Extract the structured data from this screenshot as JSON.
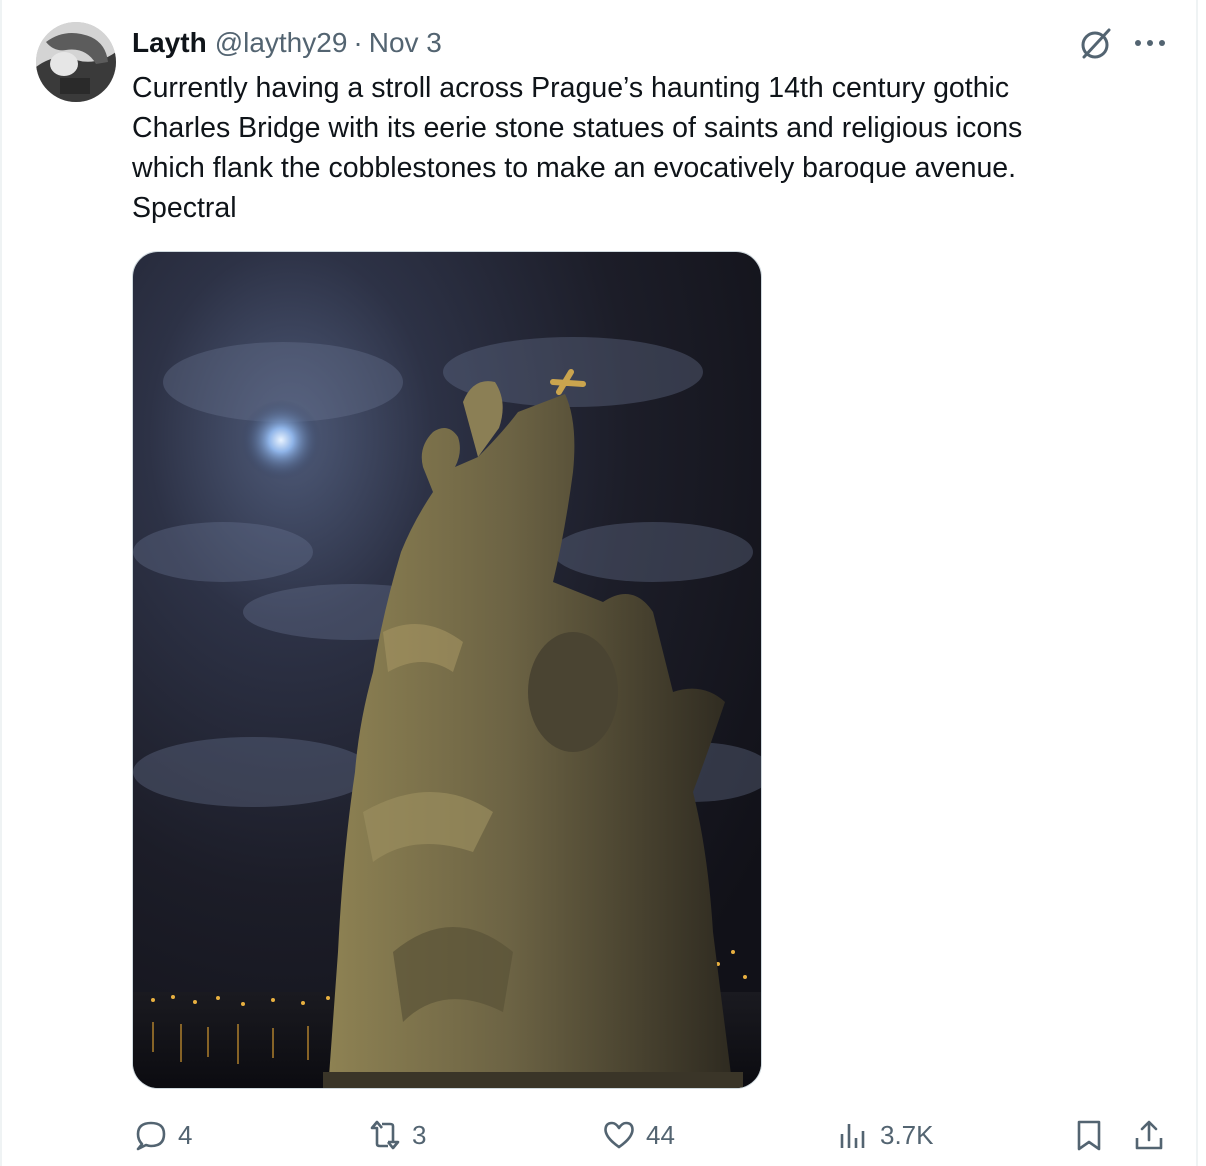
{
  "tweet": {
    "author_name": "Layth",
    "author_handle": "@laythy29",
    "separator": "·",
    "date": "Nov 3",
    "text_lines": [
      "Currently having a stroll across Prague’s haunting 14th century gothic",
      "Charles Bridge with its eerie stone statues of saints and religious icons",
      "which flank the cobblestones to make an evocatively baroque avenue.",
      "Spectral"
    ]
  },
  "actions": {
    "replies": "4",
    "reposts": "3",
    "likes": "44",
    "views": "3.7K"
  },
  "icons": {
    "header": [
      "grok-icon",
      "more-icon"
    ],
    "actions": [
      "reply-icon",
      "repost-icon",
      "like-icon",
      "views-icon",
      "bookmark-icon",
      "share-icon"
    ]
  },
  "colors": {
    "text": "#0f1419",
    "secondary": "#536471",
    "border": "#cfd9de"
  }
}
